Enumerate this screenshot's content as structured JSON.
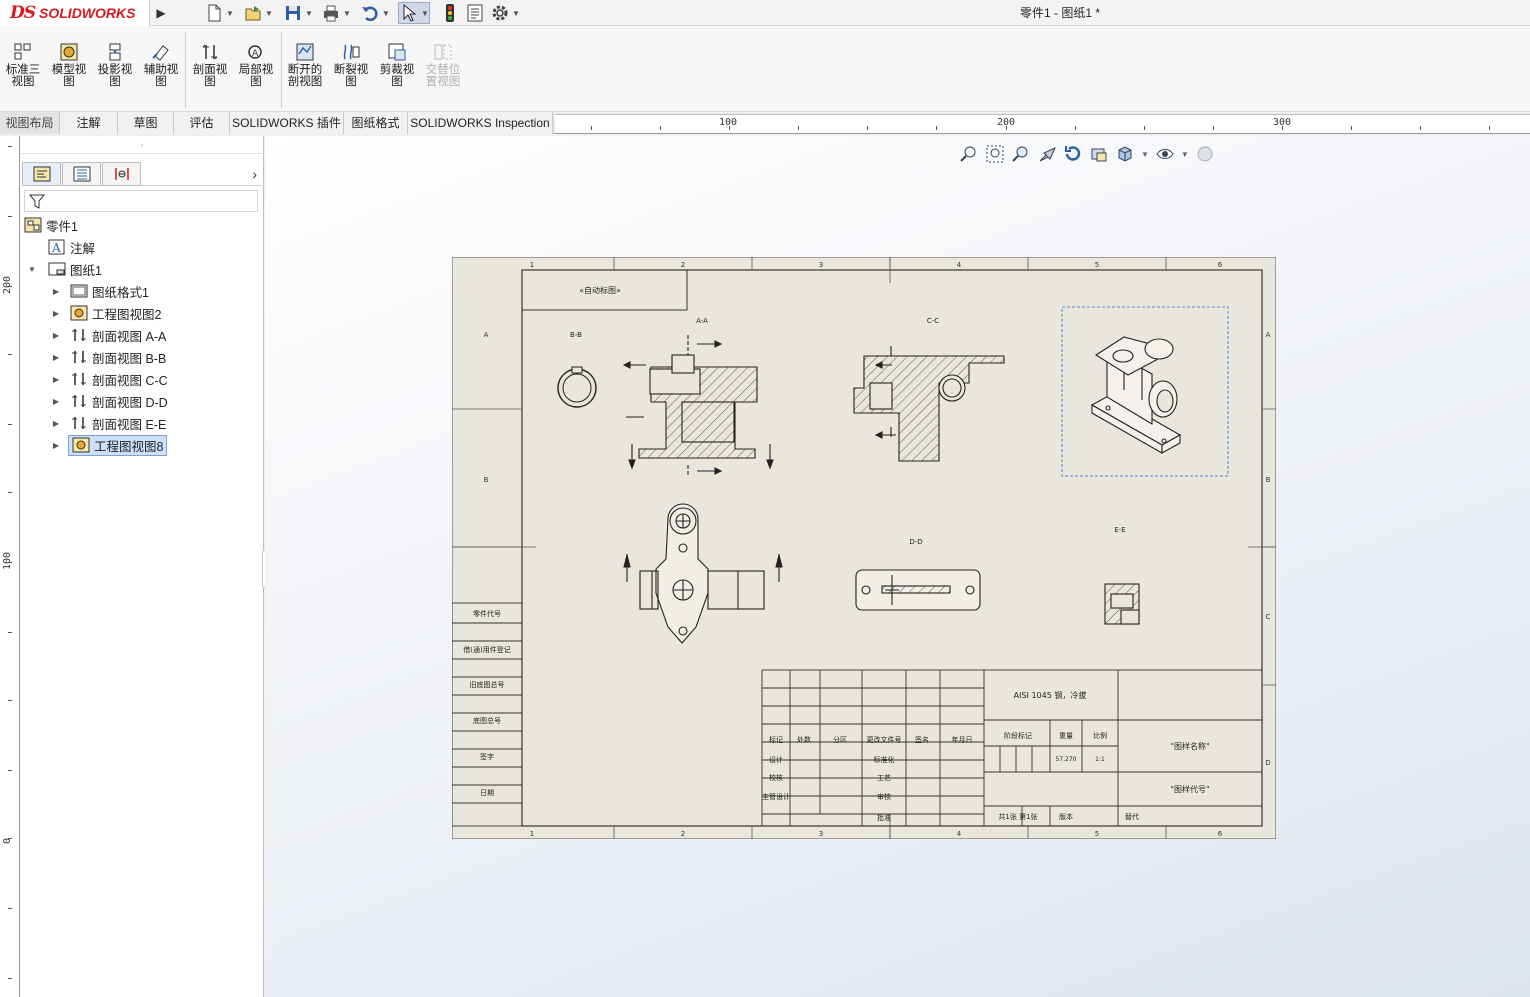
{
  "app": {
    "logo_ds": "DS",
    "logo_text": "SOLIDWORKS",
    "title": "零件1 - 图纸1 *"
  },
  "command_manager": {
    "buttons": [
      {
        "id": "standard-3-view",
        "label": "标准三\n视图",
        "label1": "标准三",
        "label2": "视图"
      },
      {
        "id": "model-view",
        "label1": "模型视",
        "label2": "图"
      },
      {
        "id": "projected-view",
        "label1": "投影视",
        "label2": "图"
      },
      {
        "id": "auxiliary-view",
        "label1": "辅助视",
        "label2": "图"
      },
      {
        "id": "section-view",
        "label1": "剖面视",
        "label2": "图"
      },
      {
        "id": "detail-view",
        "label1": "局部视",
        "label2": "图"
      },
      {
        "id": "broken-out-section",
        "label1": "断开的",
        "label2": "剖视图"
      },
      {
        "id": "break",
        "label1": "断裂视",
        "label2": "图"
      },
      {
        "id": "crop-view",
        "label1": "剪裁视",
        "label2": "图"
      },
      {
        "id": "alternate-position",
        "label1": "交替位",
        "label2": "置视图"
      }
    ]
  },
  "tabs": [
    {
      "label": "视图布局"
    },
    {
      "label": "注解"
    },
    {
      "label": "草图"
    },
    {
      "label": "评估"
    },
    {
      "label": "SOLIDWORKS 插件"
    },
    {
      "label": "图纸格式"
    },
    {
      "label": "SOLIDWORKS Inspection"
    }
  ],
  "ruler": {
    "h_labels": [
      "100",
      "200",
      "300"
    ],
    "v_labels": [
      "200",
      "100",
      "0"
    ]
  },
  "tree": {
    "root": "零件1",
    "annotations": "注解",
    "sheet": "图纸1",
    "children": [
      "图纸格式1",
      "工程图视图2",
      "剖面视图 A-A",
      "剖面视图 B-B",
      "剖面视图 C-C",
      "剖面视图 D-D",
      "剖面视图 E-E",
      "工程图视图8"
    ]
  },
  "drawing": {
    "note_box": "«自动标图»",
    "view_labels": {
      "bb": "B-B",
      "aa": "A-A",
      "cc": "C-C",
      "dd": "D-D",
      "ee": "E-E"
    },
    "border_cols": [
      "1",
      "2",
      "3",
      "4",
      "5",
      "6"
    ],
    "border_rows": [
      "A",
      "B",
      "C",
      "D"
    ],
    "left_strip": [
      "零件代号",
      "借(通)用件登记",
      "旧底图总号",
      "底图总号",
      "签字",
      "日期"
    ],
    "title_block": {
      "material": "AISI 1045 钢，冷拔",
      "headers": [
        "标记",
        "处数",
        "分区",
        "更改文件号",
        "签名",
        "年月日"
      ],
      "roles": [
        "设计",
        "校核",
        "主管设计"
      ],
      "roles2": [
        "标准化",
        "工艺",
        "审核",
        "批准"
      ],
      "stage_label": "阶段标记",
      "weight_label": "重量",
      "scale_label": "比例",
      "weight_value": "57.270",
      "scale_value": "1:1",
      "drawing_name": "\"图样名称\"",
      "drawing_code": "\"图样代号\"",
      "sheets_text": "共1张  第1张",
      "version_label": "版本",
      "replace_label": "替代"
    }
  }
}
